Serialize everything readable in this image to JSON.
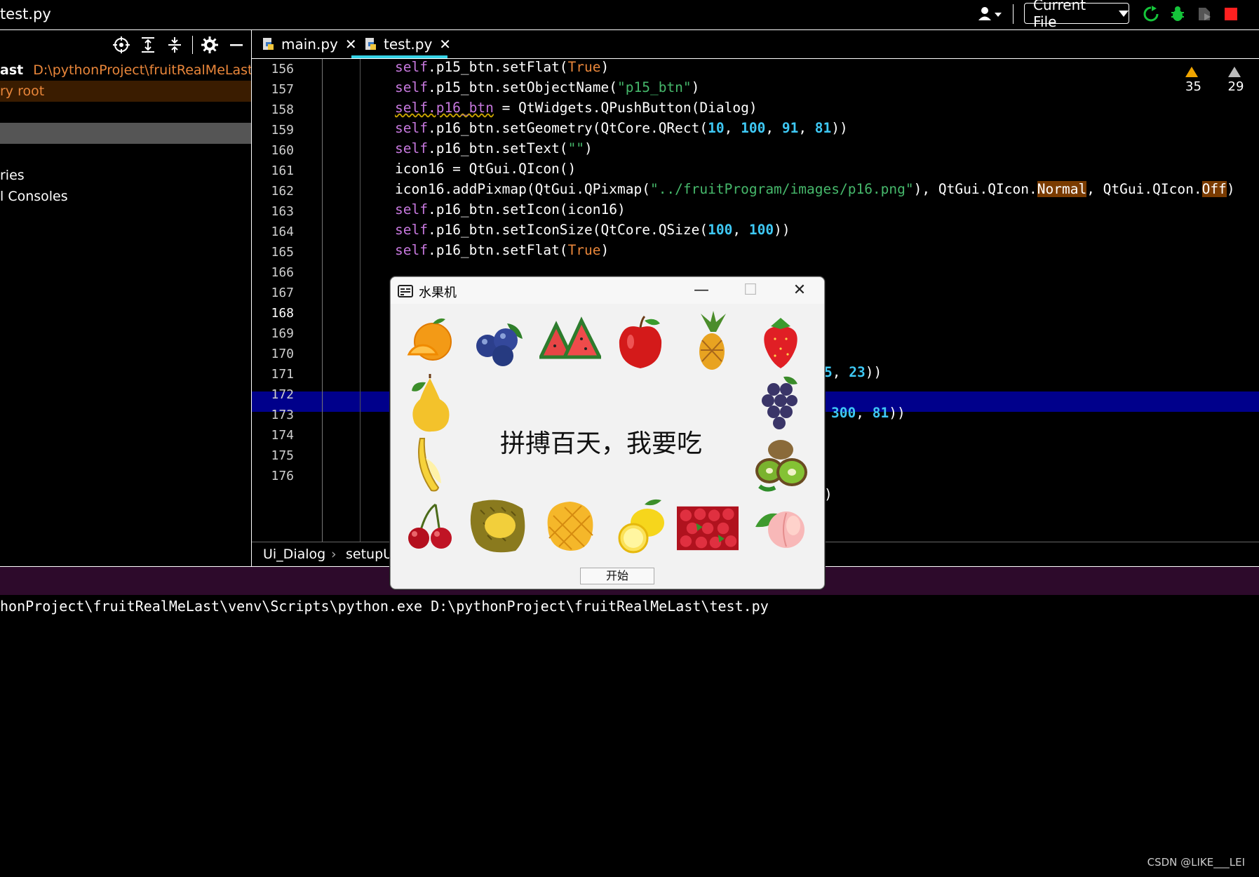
{
  "window": {
    "title": "test.py"
  },
  "toolbar": {
    "run_config": "Current File"
  },
  "project": {
    "root_name": "ast",
    "root_path": "D:\\pythonProject\\fruitRealMeLast",
    "root_subtitle": "ry root",
    "item_libraries": "ries",
    "item_consoles": "l Consoles"
  },
  "tabs": [
    {
      "label": "main.py"
    },
    {
      "label": "test.py"
    }
  ],
  "warnings": {
    "warn_count": "35",
    "weak_count": "29"
  },
  "editor": {
    "line_numbers": [
      "156",
      "157",
      "158",
      "159",
      "160",
      "161",
      "162",
      "163",
      "164",
      "165",
      "166",
      "167",
      "168",
      "169",
      "170",
      "171",
      "172",
      "173",
      "174",
      "175",
      "176"
    ],
    "current_line": "168"
  },
  "breadcrumb": {
    "class_name": "Ui_Dialog",
    "method_name": "setupU"
  },
  "console": {
    "output": "honProject\\fruitRealMeLast\\venv\\Scripts\\python.exe D:\\pythonProject\\fruitRealMeLast\\test.py"
  },
  "dialog": {
    "title": "水果机",
    "slogan": "拼搏百天，我要吃",
    "start_button": "开始",
    "fruits": [
      "orange",
      "blueberry",
      "watermelon",
      "apple",
      "pineapple",
      "strawberry",
      "pear",
      "grape",
      "banana",
      "kiwi",
      "cherry",
      "durian",
      "mango",
      "lemon",
      "bayberry",
      "peach"
    ]
  },
  "watermark": "CSDN @LIKE___LEI",
  "colors": {
    "self_kw": "#c678dd",
    "bool_kw": "#e9863a",
    "string": "#46b86b",
    "number": "#3ec8f4",
    "current_line": "#00008b",
    "tab_accent": "#35d3e6"
  }
}
